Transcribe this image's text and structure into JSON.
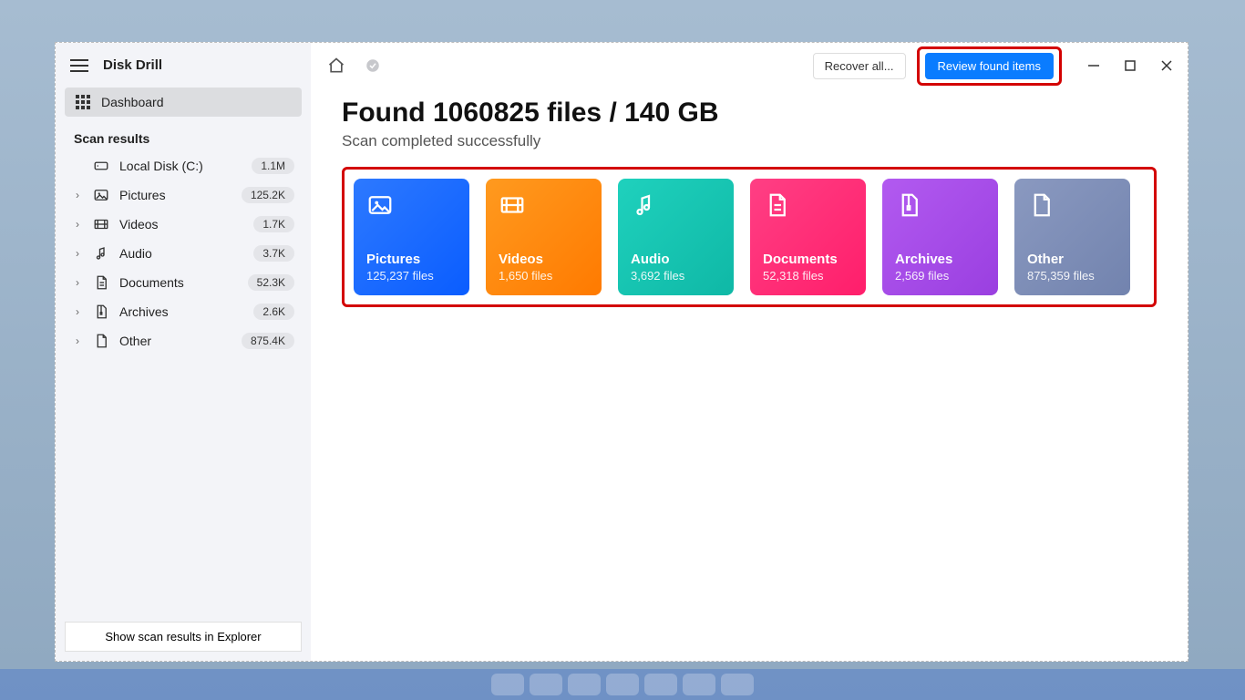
{
  "app_title": "Disk Drill",
  "sidebar": {
    "dashboard_label": "Dashboard",
    "section_label": "Scan results",
    "items": [
      {
        "label": "Local Disk (C:)",
        "count": "1.1M",
        "icon": "disk",
        "chevron": ""
      },
      {
        "label": "Pictures",
        "count": "125.2K",
        "icon": "pictures",
        "chevron": "›"
      },
      {
        "label": "Videos",
        "count": "1.7K",
        "icon": "videos",
        "chevron": "›"
      },
      {
        "label": "Audio",
        "count": "3.7K",
        "icon": "audio",
        "chevron": "›"
      },
      {
        "label": "Documents",
        "count": "52.3K",
        "icon": "documents",
        "chevron": "›"
      },
      {
        "label": "Archives",
        "count": "2.6K",
        "icon": "archives",
        "chevron": "›"
      },
      {
        "label": "Other",
        "count": "875.4K",
        "icon": "other",
        "chevron": "›"
      }
    ],
    "explorer_button": "Show scan results in Explorer"
  },
  "toolbar": {
    "recover_label": "Recover all...",
    "review_label": "Review found items"
  },
  "summary": {
    "headline": "Found 1060825 files / 140 GB",
    "subtext": "Scan completed successfully"
  },
  "cards": [
    {
      "title": "Pictures",
      "count": "125,237 files",
      "cls": "c-pictures",
      "icon": "pictures"
    },
    {
      "title": "Videos",
      "count": "1,650 files",
      "cls": "c-videos",
      "icon": "videos"
    },
    {
      "title": "Audio",
      "count": "3,692 files",
      "cls": "c-audio",
      "icon": "audio"
    },
    {
      "title": "Documents",
      "count": "52,318 files",
      "cls": "c-documents",
      "icon": "documents"
    },
    {
      "title": "Archives",
      "count": "2,569 files",
      "cls": "c-archives",
      "icon": "archives"
    },
    {
      "title": "Other",
      "count": "875,359 files",
      "cls": "c-other",
      "icon": "other"
    }
  ]
}
